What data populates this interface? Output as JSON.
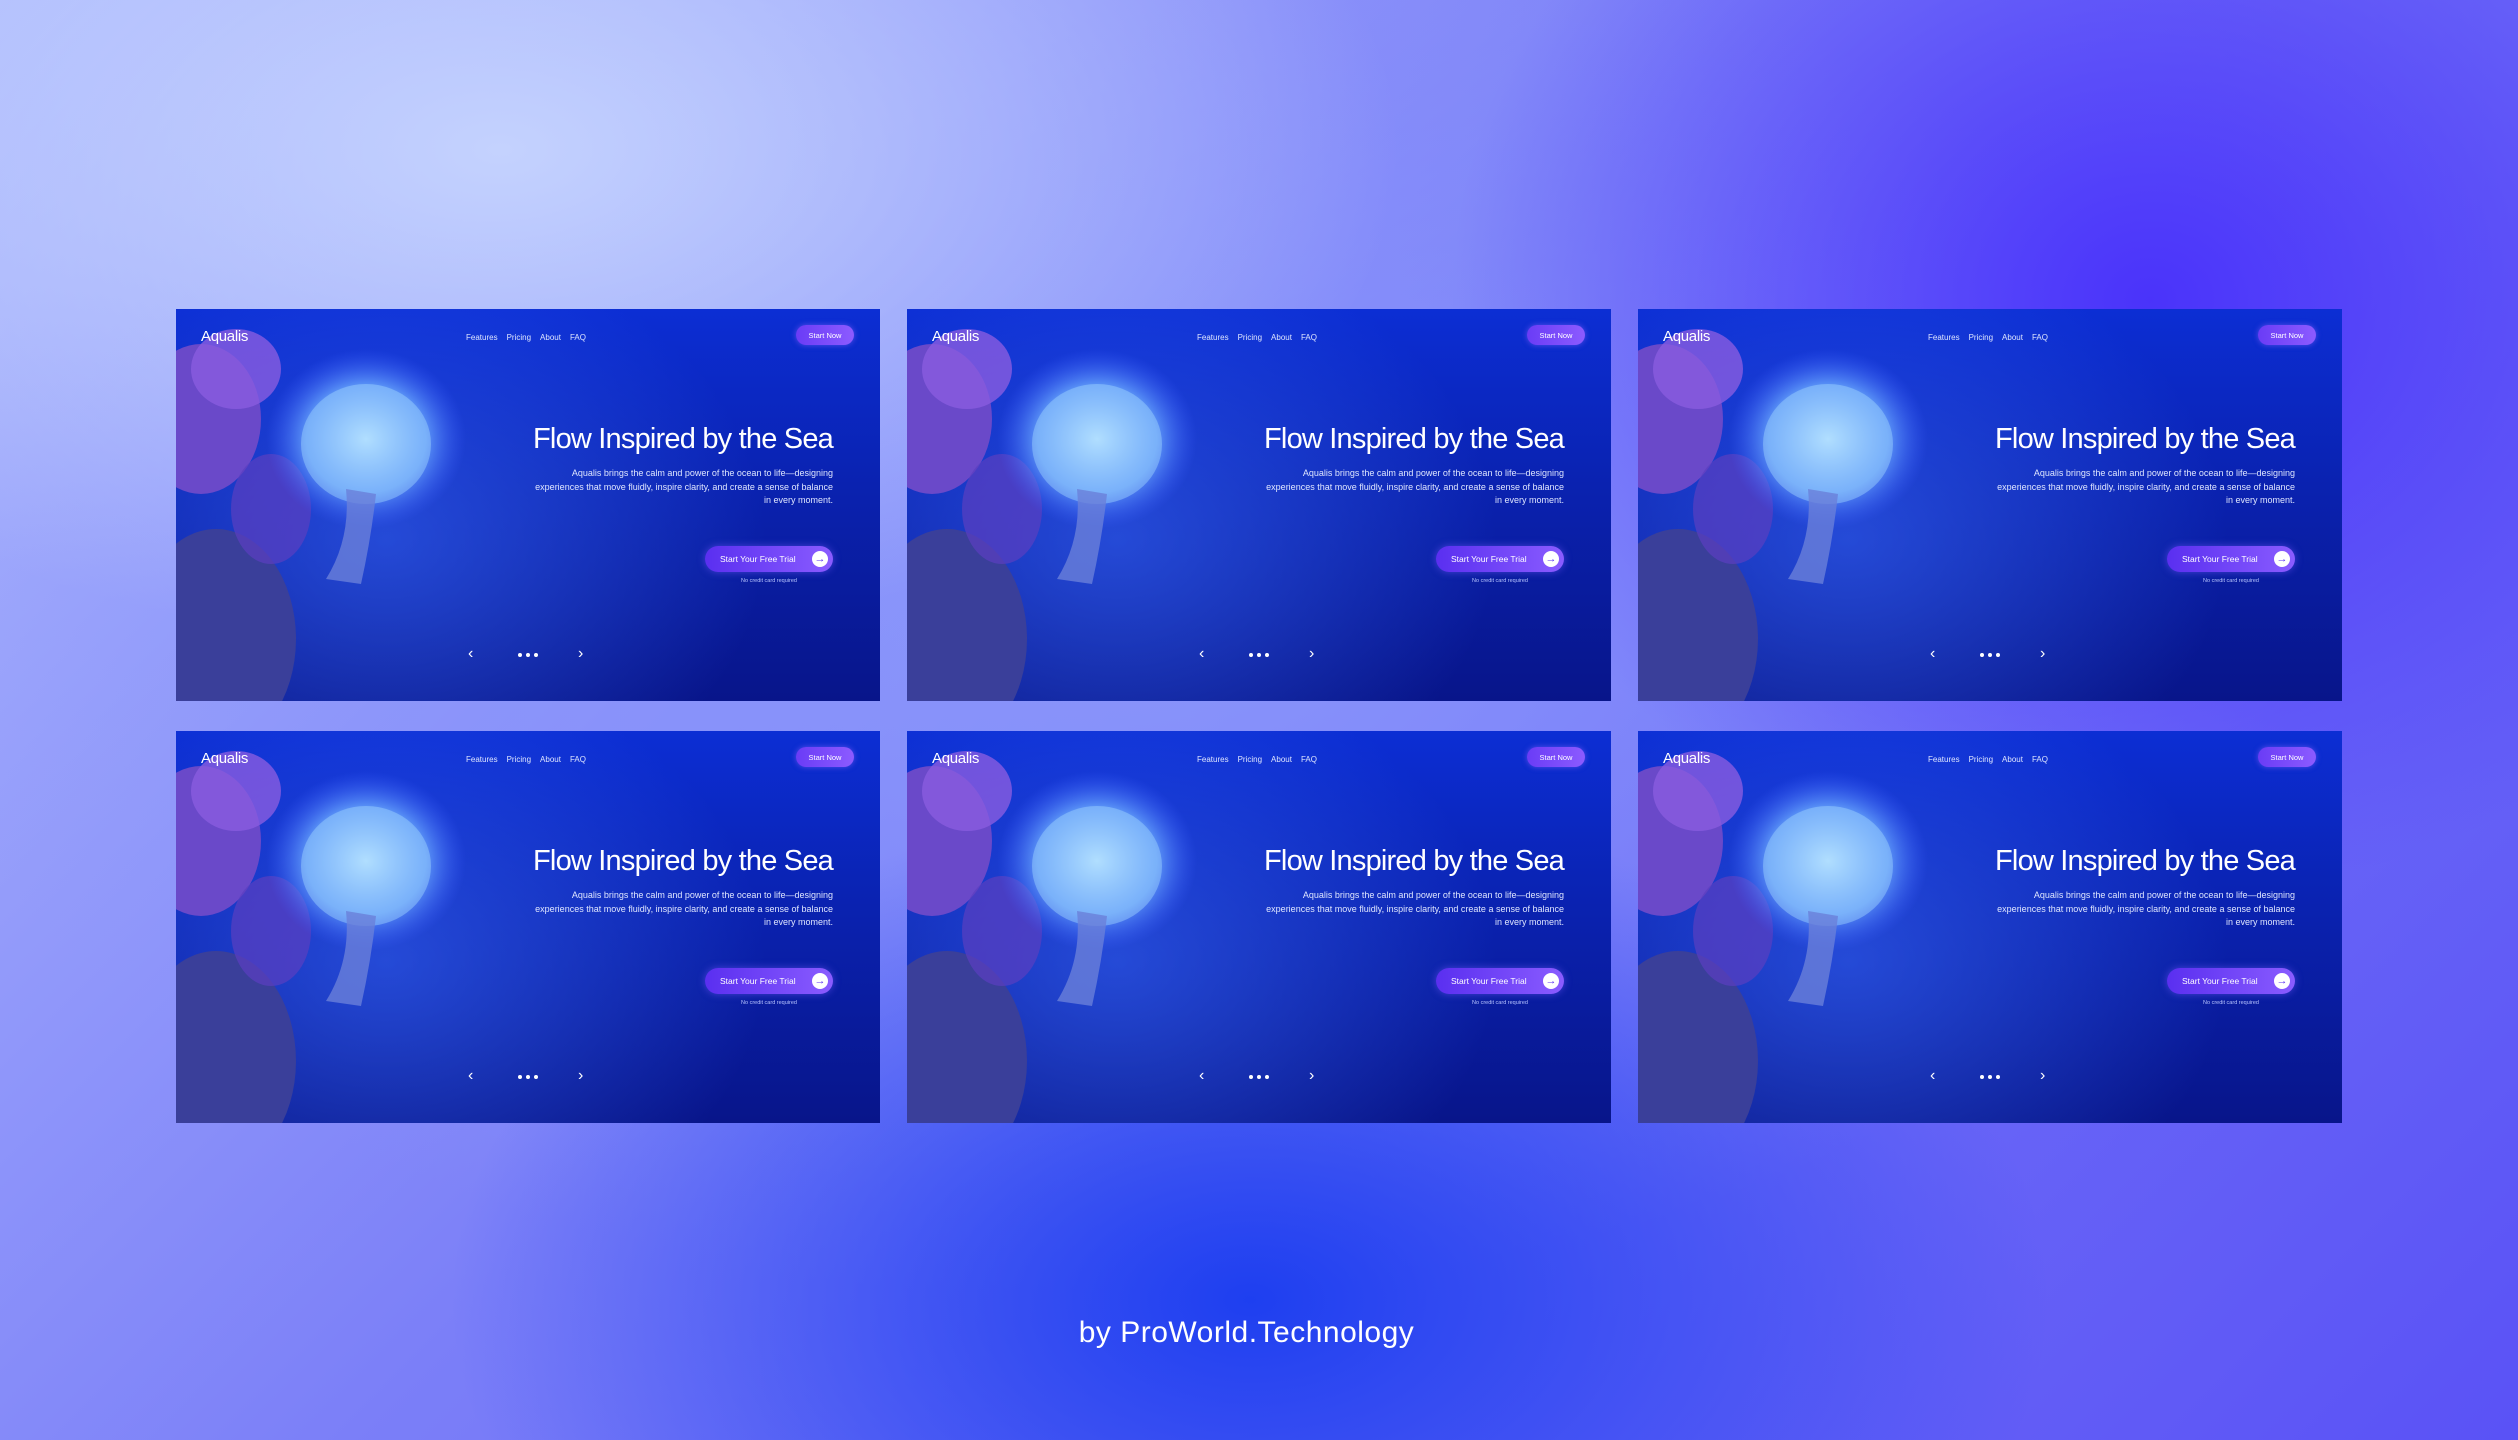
{
  "cards": [
    {
      "brand": "Aqualis",
      "nav": [
        "Features",
        "Pricing",
        "About",
        "FAQ"
      ],
      "cta_top": "Start Now",
      "title": "Flow Inspired by the Sea",
      "description": "Aqualis brings the calm and power of the ocean to life—designing experiences that move fluidly, inspire clarity, and create a sense of balance in every moment.",
      "cta_primary": "Start Your Free Trial",
      "note": "No credit card required"
    },
    {
      "brand": "Aqualis",
      "nav": [
        "Features",
        "Pricing",
        "About",
        "FAQ"
      ],
      "cta_top": "Start Now",
      "title": "Flow Inspired by the Sea",
      "description": "Aqualis brings the calm and power of the ocean to life—designing experiences that move fluidly, inspire clarity, and create a sense of balance in every moment.",
      "cta_primary": "Start Your Free Trial",
      "note": "No credit card required"
    },
    {
      "brand": "Aqualis",
      "nav": [
        "Features",
        "Pricing",
        "About",
        "FAQ"
      ],
      "cta_top": "Start Now",
      "title": "Flow Inspired by the Sea",
      "description": "Aqualis brings the calm and power of the ocean to life—designing experiences that move fluidly, inspire clarity, and create a sense of balance in every moment.",
      "cta_primary": "Start Your Free Trial",
      "note": "No credit card required"
    },
    {
      "brand": "Aqualis",
      "nav": [
        "Features",
        "Pricing",
        "About",
        "FAQ"
      ],
      "cta_top": "Start Now",
      "title": "Flow Inspired by the Sea",
      "description": "Aqualis brings the calm and power of the ocean to life—designing experiences that move fluidly, inspire clarity, and create a sense of balance in every moment.",
      "cta_primary": "Start Your Free Trial",
      "note": "No credit card required"
    },
    {
      "brand": "Aqualis",
      "nav": [
        "Features",
        "Pricing",
        "About",
        "FAQ"
      ],
      "cta_top": "Start Now",
      "title": "Flow Inspired by the Sea",
      "description": "Aqualis brings the calm and power of the ocean to life—designing experiences that move fluidly, inspire clarity, and create a sense of balance in every moment.",
      "cta_primary": "Start Your Free Trial",
      "note": "No credit card required"
    },
    {
      "brand": "Aqualis",
      "nav": [
        "Features",
        "Pricing",
        "About",
        "FAQ"
      ],
      "cta_top": "Start Now",
      "title": "Flow Inspired by the Sea",
      "description": "Aqualis brings the calm and power of the ocean to life—designing experiences that move fluidly, inspire clarity, and create a sense of balance in every moment.",
      "cta_primary": "Start Your Free Trial",
      "note": "No credit card required"
    }
  ],
  "icons": {
    "prev": "chevron-left-icon",
    "next": "chevron-right-icon",
    "dots": "pagination-dots-icon",
    "arrow": "arrow-right-circle-icon"
  },
  "colors": {
    "accent": "#7a4cff",
    "hero_blue": "#0c2ed4"
  },
  "credit": "by ProWorld.Technology"
}
